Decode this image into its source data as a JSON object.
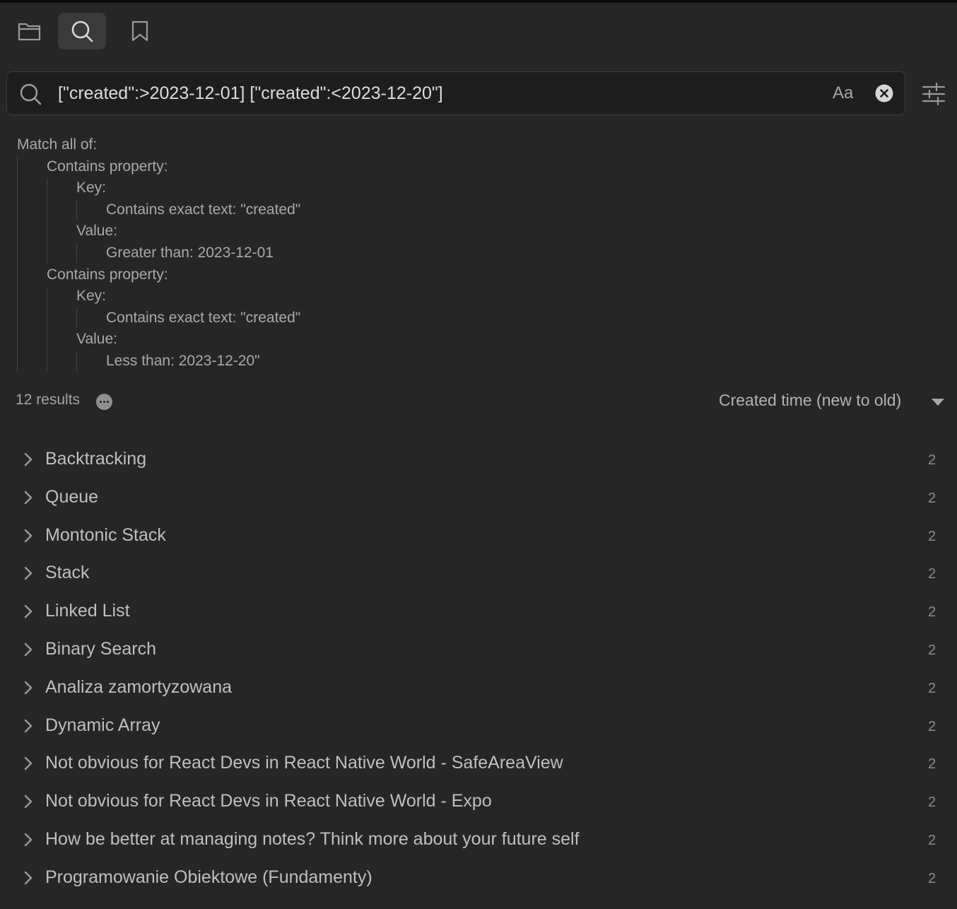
{
  "tabs": [
    {
      "name": "files-tab",
      "icon": "folder-icon"
    },
    {
      "name": "search-tab",
      "icon": "search-icon",
      "active": true
    },
    {
      "name": "bookmarks-tab",
      "icon": "bookmark-icon"
    }
  ],
  "search": {
    "value": "[\"created\":>2023-12-01] [\"created\":<2023-12-20\"]",
    "match_case_label": "Aa"
  },
  "explain": {
    "root": "Match all of:",
    "prop1": "Contains property:",
    "prop1_key": "Key:",
    "prop1_key_val": "Contains exact text: \"created\"",
    "prop1_value": "Value:",
    "prop1_value_val": "Greater than: 2023-12-01",
    "prop2": "Contains property:",
    "prop2_key": "Key:",
    "prop2_key_val": "Contains exact text: \"created\"",
    "prop2_value": "Value:",
    "prop2_value_val": "Less than: 2023-12-20\""
  },
  "results_header": {
    "count_label": "12 results",
    "sort_label": "Created time (new to old)"
  },
  "results": [
    {
      "title": "Backtracking",
      "count": "2"
    },
    {
      "title": "Queue",
      "count": "2"
    },
    {
      "title": "Montonic Stack",
      "count": "2"
    },
    {
      "title": "Stack",
      "count": "2"
    },
    {
      "title": "Linked List",
      "count": "2"
    },
    {
      "title": "Binary Search",
      "count": "2"
    },
    {
      "title": "Analiza zamortyzowana",
      "count": "2"
    },
    {
      "title": "Dynamic Array",
      "count": "2"
    },
    {
      "title": "Not obvious for React Devs in React Native World - SafeAreaView",
      "count": "2"
    },
    {
      "title": "Not obvious for React Devs in React Native World - Expo",
      "count": "2"
    },
    {
      "title": "How be better at managing notes? Think more about your future self",
      "count": "2"
    },
    {
      "title": "Programowanie Obiektowe (Fundamenty)",
      "count": "2"
    }
  ],
  "colors": {
    "background": "#262626",
    "input_background": "#1e1e1e",
    "text": "#bfbfbf",
    "muted_text": "#8c8c8c"
  }
}
